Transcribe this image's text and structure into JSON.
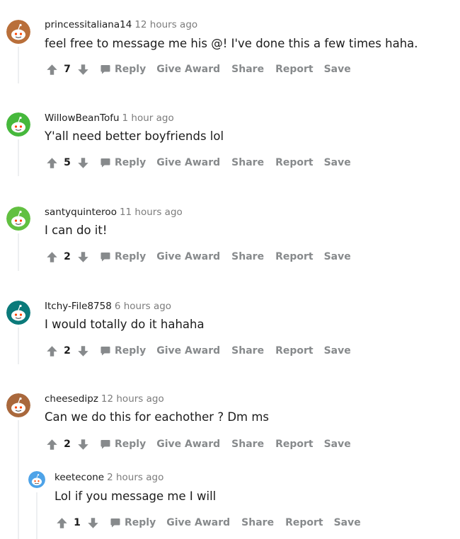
{
  "comments": [
    {
      "username": "princessitaliana14",
      "time": "12 hours ago",
      "text": "feel free to message me his @! I've done this a few times haha.",
      "score": "7",
      "avatar_color": "#b96f3a"
    },
    {
      "username": "WillowBeanTofu",
      "time": "1 hour ago",
      "text": "Y'all need better boyfriends lol",
      "score": "5",
      "avatar_color": "#46b83c"
    },
    {
      "username": "santyquinteroo",
      "time": "11 hours ago",
      "text": "I can do it!",
      "score": "2",
      "avatar_color": "#62c041"
    },
    {
      "username": "Itchy-File8758",
      "time": "6 hours ago",
      "text": "I would totally do it hahaha",
      "score": "2",
      "avatar_color": "#0b7a7a"
    },
    {
      "username": "cheesedipz",
      "time": "12 hours ago",
      "text": "Can we do this for eachother ? Dm ms",
      "score": "2",
      "avatar_color": "#a9683c"
    },
    {
      "username": "keetecone",
      "time": "2 hours ago",
      "text": "Lol if you message me I will",
      "score": "1",
      "avatar_color": "#4ea3e8"
    }
  ],
  "actions": {
    "reply": "Reply",
    "give_award": "Give Award",
    "share": "Share",
    "report": "Report",
    "save": "Save"
  },
  "colors": {
    "action_gray": "#878a8c",
    "thread_line": "#edeff1",
    "meta_gray": "#7c7c7c"
  }
}
